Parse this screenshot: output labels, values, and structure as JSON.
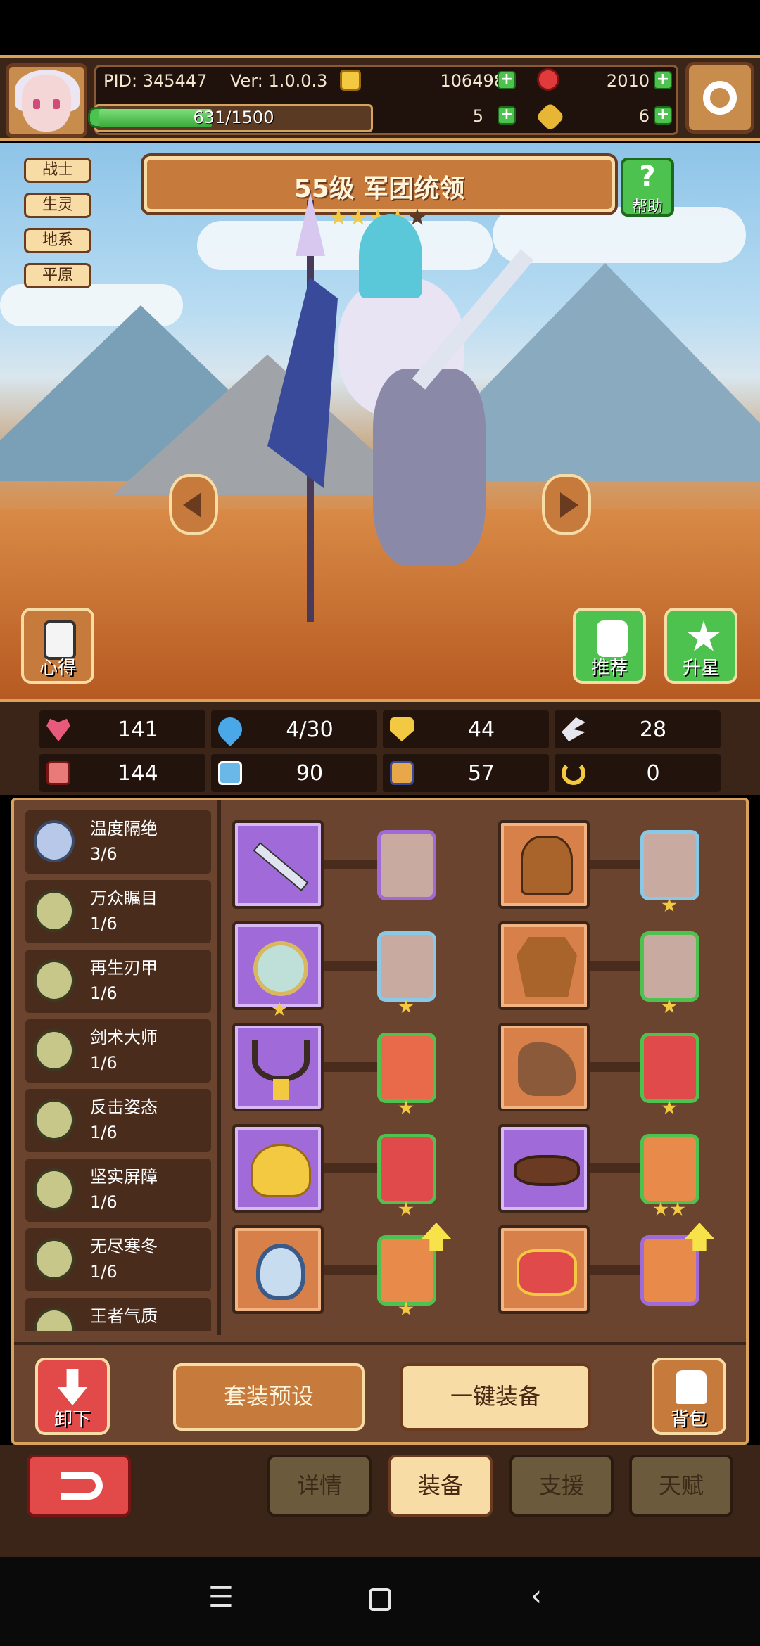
{
  "hud": {
    "pid": "PID: 345447",
    "version": "Ver: 1.0.0.3",
    "exp": "631/1500",
    "exp_ratio": 0.42,
    "gold": "106498",
    "gems": "2010",
    "clover": "5",
    "keys": "6"
  },
  "hero": {
    "tags": [
      "战士",
      "生灵",
      "地系",
      "平原"
    ],
    "title": "55级  军团统领",
    "stars_filled": 4,
    "stars_total": 5,
    "help_label": "帮助",
    "notes_label": "心得",
    "recommend_label": "推荐",
    "upstar_label": "升星"
  },
  "stats": [
    {
      "icon": "heart-icon",
      "value": "141",
      "color": "#e85a7a"
    },
    {
      "icon": "water-drop-icon",
      "value": "4/30",
      "color": "#4aa8e8"
    },
    {
      "icon": "shield-icon",
      "value": "44",
      "color": "#f2c940"
    },
    {
      "icon": "wing-icon",
      "value": "28",
      "color": "#e6e6ee"
    },
    {
      "icon": "fist-icon",
      "value": "144",
      "color": "#e87a7a"
    },
    {
      "icon": "book-icon",
      "value": "90",
      "color": "#6ab8e8"
    },
    {
      "icon": "scroll-icon",
      "value": "57",
      "color": "#e8a84a"
    },
    {
      "icon": "horseshoe-icon",
      "value": "0",
      "color": "#f2c940"
    }
  ],
  "skills": [
    {
      "name": "温度隔绝",
      "level": "3/6"
    },
    {
      "name": "万众瞩目",
      "level": "1/6"
    },
    {
      "name": "再生刃甲",
      "level": "1/6"
    },
    {
      "name": "剑术大师",
      "level": "1/6"
    },
    {
      "name": "反击姿态",
      "level": "1/6"
    },
    {
      "name": "坚实屏障",
      "level": "1/6"
    },
    {
      "name": "无尽寒冬",
      "level": "1/6"
    },
    {
      "name": "王者气质",
      "level": ""
    }
  ],
  "equipment": {
    "unequip_label": "卸下",
    "preset_label": "套装预设",
    "auto_equip_label": "一键装备",
    "bag_label": "背包"
  },
  "tabs": {
    "details": "详情",
    "equip": "装备",
    "support": "支援",
    "talent": "天赋"
  },
  "colors": {
    "purple_rarity": "#a06bd8",
    "orange_rarity": "#d8804a",
    "accent_gold": "#d8a25a"
  }
}
